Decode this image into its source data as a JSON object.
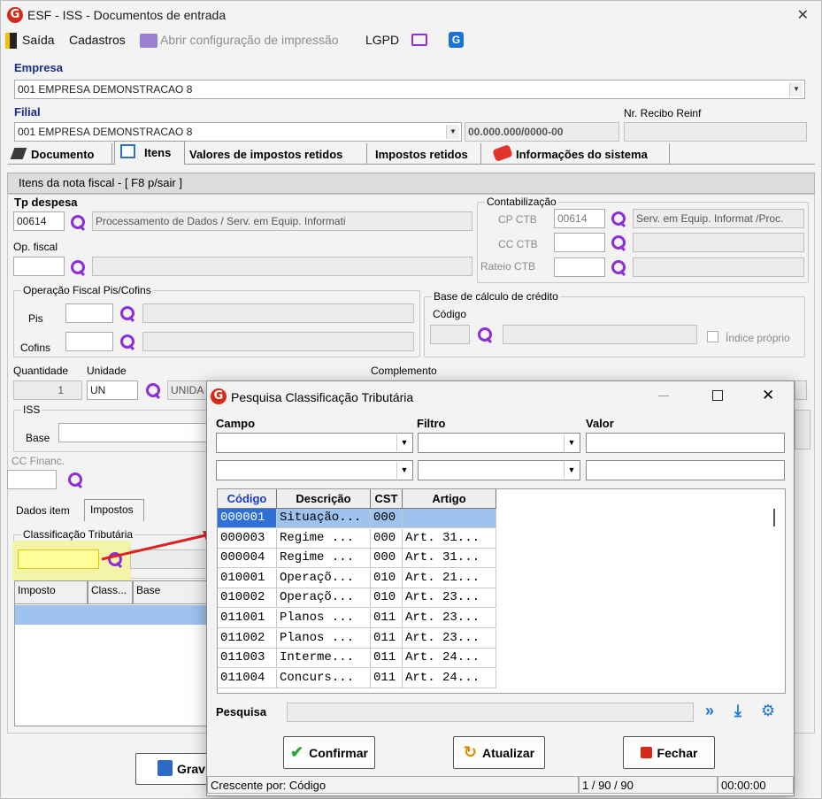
{
  "window": {
    "title": "ESF - ISS - Documentos de entrada",
    "close": "✕"
  },
  "menu": {
    "saida": "Saída",
    "cadastros": "Cadastros",
    "abrir_config": "Abrir configuração de impressão",
    "lgpd": "LGPD"
  },
  "empresa": {
    "label": "Empresa",
    "value": "001 EMPRESA DEMONSTRACAO 8"
  },
  "filial": {
    "label": "Filial",
    "value": "001 EMPRESA DEMONSTRACAO 8",
    "cnpj": "00.000.000/0000-00",
    "reinf_label": "Nr. Recibo Reinf",
    "reinf_value": ""
  },
  "tabs": [
    "Documento",
    "Itens",
    "Valores de impostos retidos",
    "Impostos retidos",
    "Informações do sistema"
  ],
  "itens": {
    "section_title": "Itens da nota fiscal - [ F8 p/sair ]",
    "tp_despesa_label": "Tp despesa",
    "tp_despesa_code": "00614",
    "tp_despesa_desc": "Processamento de Dados / Serv. em Equip. Informati",
    "op_fiscal_label": "Op. fiscal",
    "contab": {
      "legend": "Contabilização",
      "cp_label": "CP CTB",
      "cp_code": "00614",
      "cp_desc": "Serv. em Equip. Informat /Proc.",
      "cc_label": "CC CTB",
      "rateio_label": "Rateio CTB"
    },
    "pis_cofins": {
      "legend": "Operação Fiscal Pis/Cofins",
      "pis": "Pis",
      "cofins": "Cofins"
    },
    "base_credito": {
      "legend": "Base de cálculo de crédito",
      "codigo": "Código",
      "indice": "Índice próprio"
    },
    "quantidade_label": "Quantidade",
    "quantidade_value": "1",
    "unidade_label": "Unidade",
    "unidade_value": "UN",
    "unidade_desc": "UNIDA",
    "complemento_label": "Complemento",
    "iss_legend": "ISS",
    "base_label": "Base",
    "cc_financ_label": "CC Financ.",
    "subtabs": [
      "Dados item",
      "Impostos"
    ],
    "class_trib_legend": "Classificação Tributária",
    "impostos_grid": [
      "Imposto",
      "Class...",
      "Base"
    ],
    "gravar": "Grav"
  },
  "dialog": {
    "title": "Pesquisa Classificação Tributária",
    "campo": "Campo",
    "filtro": "Filtro",
    "valor": "Valor",
    "columns": [
      "Código",
      "Descrição",
      "CST",
      "Artigo"
    ],
    "rows": [
      [
        "000001",
        "Situação...",
        "000",
        ""
      ],
      [
        "000003",
        "Regime ...",
        "000",
        "Art. 31..."
      ],
      [
        "000004",
        "Regime ...",
        "000",
        "Art. 31..."
      ],
      [
        "010001",
        "Operaçõ...",
        "010",
        "Art. 21..."
      ],
      [
        "010002",
        "Operaçõ...",
        "010",
        "Art. 23..."
      ],
      [
        "011001",
        "Planos ...",
        "011",
        "Art. 23..."
      ],
      [
        "011002",
        "Planos ...",
        "011",
        "Art. 23..."
      ],
      [
        "011003",
        "Interme...",
        "011",
        "Art. 24..."
      ],
      [
        "011004",
        "Concurs...",
        "011",
        "Art. 24..."
      ]
    ],
    "pesquisa": "Pesquisa",
    "confirmar": "Confirmar",
    "atualizar": "Atualizar",
    "fechar": "Fechar",
    "status_sort": "Crescente por: Código",
    "status_pos": "1 / 90 / 90",
    "status_time": "00:00:00"
  },
  "colors": {
    "accent_purple": "#8b2fd8",
    "selection": "#9ec3ef",
    "dark_blue": "#1a2c8c",
    "brand_red": "#d42a1a"
  }
}
